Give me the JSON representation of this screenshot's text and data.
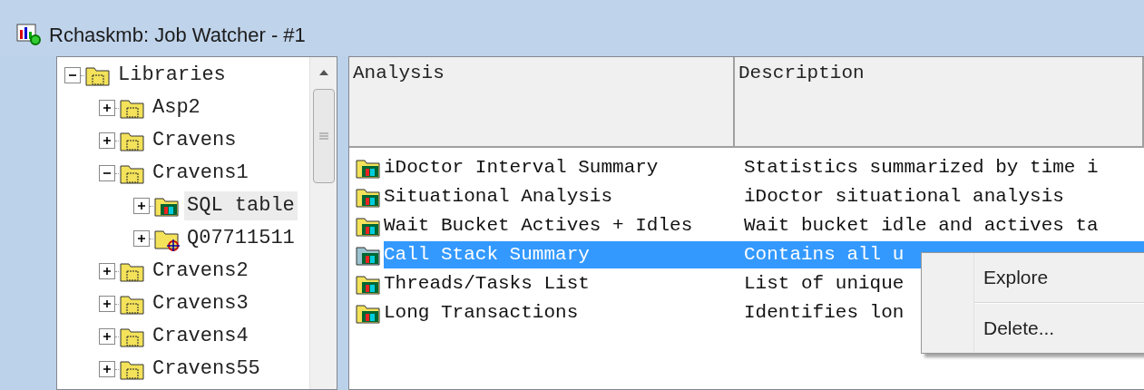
{
  "window": {
    "title": "Rchaskmb:  Job Watcher - #1"
  },
  "tree": [
    {
      "label": "Libraries",
      "kind": "library",
      "expanded": true,
      "selected": false,
      "children": [
        {
          "label": "Asp2",
          "kind": "library",
          "expanded": false,
          "selected": false
        },
        {
          "label": "Cravens",
          "kind": "library",
          "expanded": false,
          "selected": false
        },
        {
          "label": "Cravens1",
          "kind": "library",
          "expanded": true,
          "selected": false,
          "children": [
            {
              "label": "SQL table",
              "kind": "analysis",
              "expanded": false,
              "selected": true
            },
            {
              "label": "Q07711511",
              "kind": "collection",
              "expanded": false,
              "selected": false
            }
          ]
        },
        {
          "label": "Cravens2",
          "kind": "library",
          "expanded": false,
          "selected": false
        },
        {
          "label": "Cravens3",
          "kind": "library",
          "expanded": false,
          "selected": false
        },
        {
          "label": "Cravens4",
          "kind": "library",
          "expanded": false,
          "selected": false
        },
        {
          "label": "Cravens55",
          "kind": "library",
          "expanded": false,
          "selected": false
        }
      ]
    }
  ],
  "table": {
    "columns": [
      "Analysis",
      "Description"
    ],
    "rows": [
      {
        "analysis": "iDoctor Interval Summary",
        "description": "Statistics summarized by time i",
        "selected": false
      },
      {
        "analysis": "Situational Analysis",
        "description": "iDoctor situational analysis",
        "selected": false
      },
      {
        "analysis": "Wait Bucket Actives + Idles",
        "description": "Wait bucket idle and actives ta",
        "selected": false
      },
      {
        "analysis": "Call Stack Summary",
        "description": "Contains all u",
        "selected": true
      },
      {
        "analysis": "Threads/Tasks List",
        "description": "List of unique",
        "selected": false
      },
      {
        "analysis": "Long Transactions",
        "description": "Identifies lon",
        "selected": false
      }
    ]
  },
  "context_menu": {
    "items": [
      "Explore",
      "Delete..."
    ]
  }
}
